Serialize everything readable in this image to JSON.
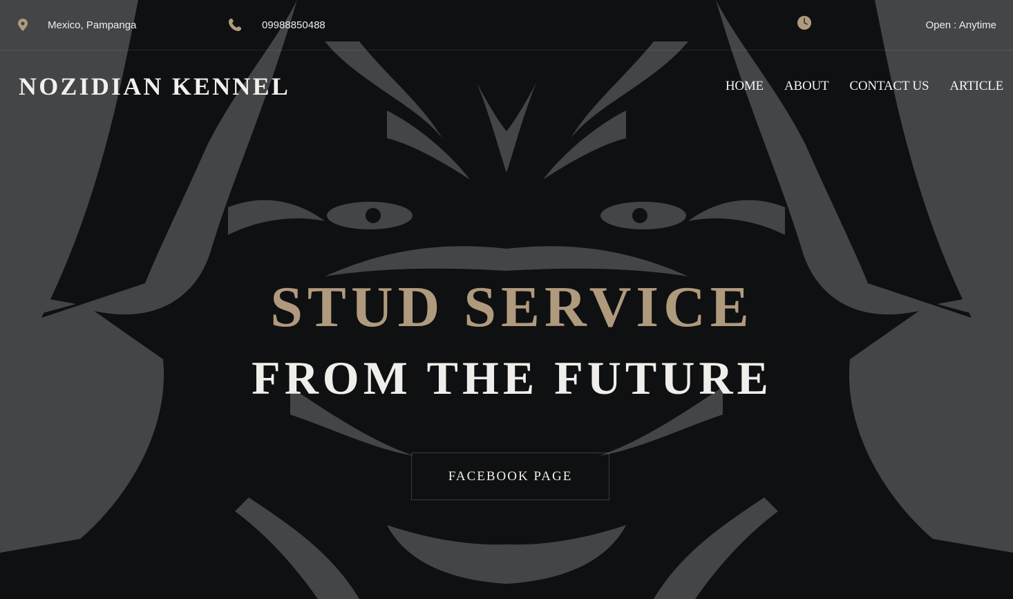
{
  "topbar": {
    "location": {
      "icon": "map-pin-icon",
      "text": "Mexico, Pampanga"
    },
    "phone": {
      "icon": "phone-icon",
      "text": "09988850488"
    },
    "hours": {
      "icon": "clock-icon",
      "text": "Open : Anytime"
    }
  },
  "header": {
    "brand": "NOZIDIAN KENNEL",
    "nav": [
      {
        "label": "HOME"
      },
      {
        "label": "ABOUT"
      },
      {
        "label": "CONTACT US"
      },
      {
        "label": "ARTICLE"
      }
    ]
  },
  "hero": {
    "headline": "STUD SERVICE",
    "subheadline": "FROM THE FUTURE",
    "button_label": "FACEBOOK PAGE",
    "background_art": "tribal-dog-face-illustration"
  },
  "colors": {
    "accent": "#b09a7d",
    "background": "#434546",
    "art_dark": "#0f1011",
    "text": "#efeeea"
  }
}
